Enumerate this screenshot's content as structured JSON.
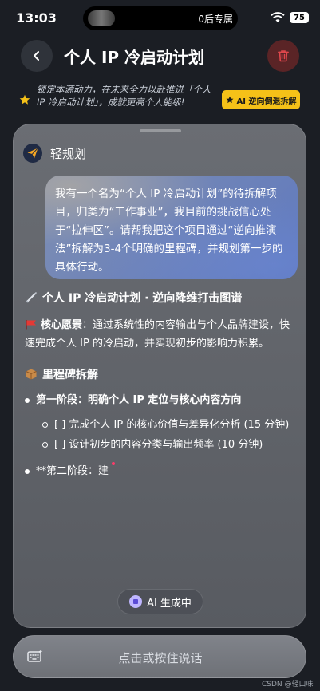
{
  "status_bar": {
    "time": "13:03",
    "island_text": "0后专属",
    "battery": "75"
  },
  "header": {
    "title": "个人 IP 冷启动计划"
  },
  "banner": {
    "text": "锁定本源动力，在未来全力以赴推进「个人 IP 冷启动计划」，成就更高个人能级!",
    "button_label": "AI 逆向倒退拆解"
  },
  "chat": {
    "assistant_name": "轻规划",
    "user_message": "我有一个名为“个人 IP 冷启动计划”的待拆解项目，归类为“工作事业”，我目前的挑战信心处于“拉伸区”。请帮我把这个项目通过“逆向推演法”拆解为3-4个明确的里程碑，并规划第一步的具体行动。",
    "response": {
      "heading": "个人 IP 冷启动计划 · 逆向降维打击图谱",
      "vision_label": "核心愿景",
      "vision_text": "：通过系统性的内容输出与个人品牌建设，快速完成个人 IP 的冷启动，并实现初步的影响力积累。",
      "milestones_heading": "里程碑拆解",
      "phase1_title": "第一阶段：明确个人 IP 定位与核心内容方向",
      "phase1_tasks": [
        "[ ] 完成个人 IP 的核心价值与差异化分析 (15 分钟)",
        "[ ] 设计初步的内容分类与输出频率 (10 分钟)"
      ],
      "phase2_partial": "**第二阶段：建"
    },
    "generating_label": "AI 生成中"
  },
  "input": {
    "voice_label": "点击或按住说话"
  },
  "watermark": "CSDN @轻口味",
  "colors": {
    "accent_yellow": "#f5c118",
    "delete_red": "#e0474c",
    "bubble_blue": "#5e78bf",
    "cursor_pink": "#ff3b6a"
  }
}
